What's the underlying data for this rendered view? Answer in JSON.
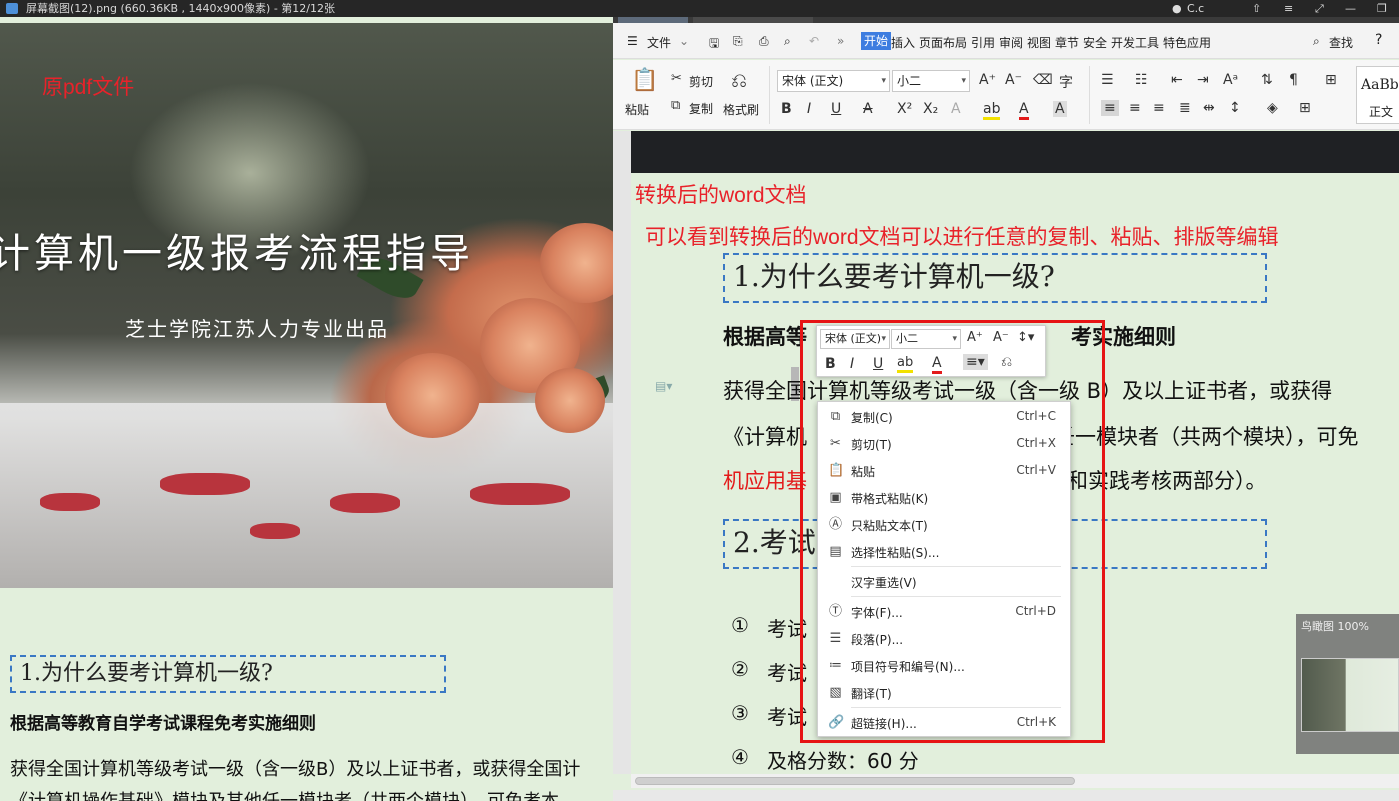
{
  "titlebar": {
    "title": "屏幕截图(12).png (660.36KB , 1440x900像素) - 第12/12张",
    "user": "C.c"
  },
  "left": {
    "label": "原pdf文件",
    "photo_title": "计算机一级报考流程指导",
    "photo_subtitle": "芝士学院江苏人力专业出品",
    "heading1": "1.为什么要考计算机一级?",
    "bold_line": "根据高等教育自学考试课程免考实施细则",
    "para_line1": "获得全国计算机等级考试一级（含一级B）及以上证书者，或获得全国计",
    "para_line2": "《计算机操作基础》模块及其他任一模块者（共两个模块），可免考本"
  },
  "menu": {
    "file": "文件",
    "items": [
      "开始",
      "插入",
      "页面布局",
      "引用",
      "审阅",
      "视图",
      "章节",
      "安全",
      "开发工具",
      "特色应用"
    ],
    "search": "查找",
    "help": "?"
  },
  "ribbon": {
    "paste": "粘贴",
    "cut": "剪切",
    "copy": "复制",
    "format_painter": "格式刷",
    "font_name": "宋体 (正文)",
    "font_size": "小二",
    "style_preview": "AaBb",
    "style_name": "正文"
  },
  "doc": {
    "label_converted": "转换后的word文档",
    "label_note": "可以看到转换后的word文档可以进行任意的复制、粘贴、排版等编辑",
    "heading1": "1.为什么要考计算机一级?",
    "bold_left": "根据高等",
    "bold_right": "考实施细则",
    "para1": "获得全国计算机等级考试一级（含一级 B）及以上证书者，或获得",
    "para2_left": "《计算机",
    "para2_right": "壬一模块者（共两个模块），可免",
    "para3_red": "机应用基",
    "para3_right": "和实践考核两部分）。",
    "heading2": "2.考试",
    "list": [
      {
        "num": "①",
        "text": "考试"
      },
      {
        "num": "②",
        "text": "考试"
      },
      {
        "num": "③",
        "text": "考试"
      },
      {
        "num": "④",
        "text": "及格分数：60 分"
      }
    ]
  },
  "minimap": {
    "title": "鸟瞰图 100%"
  },
  "minitoolbar": {
    "font_name": "宋体 (正文)",
    "font_size": "小二"
  },
  "context_menu": [
    {
      "label": "复制(C)",
      "key": "Ctrl+C",
      "icon": "copy-icon",
      "glyph": "⧉"
    },
    {
      "label": "剪切(T)",
      "key": "Ctrl+X",
      "icon": "scissors-icon",
      "glyph": "✂"
    },
    {
      "label": "粘贴",
      "key": "Ctrl+V",
      "icon": "paste-icon",
      "glyph": "📋"
    },
    {
      "label": "带格式粘贴(K)",
      "key": "",
      "icon": "paste-format-icon",
      "glyph": "▣"
    },
    {
      "label": "只粘贴文本(T)",
      "key": "",
      "icon": "paste-text-icon",
      "glyph": "Ⓐ"
    },
    {
      "label": "选择性粘贴(S)...",
      "key": "",
      "icon": "paste-special-icon",
      "glyph": "▤"
    },
    {
      "label": "汉字重选(V)",
      "key": "",
      "icon": "",
      "glyph": ""
    },
    {
      "label": "字体(F)...",
      "key": "Ctrl+D",
      "icon": "font-icon",
      "glyph": "Ⓣ"
    },
    {
      "label": "段落(P)...",
      "key": "",
      "icon": "paragraph-icon",
      "glyph": "☰"
    },
    {
      "label": "项目符号和编号(N)...",
      "key": "",
      "icon": "bullets-icon",
      "glyph": "≔"
    },
    {
      "label": "翻译(T)",
      "key": "",
      "icon": "translate-icon",
      "glyph": "▧"
    },
    {
      "label": "超链接(H)...",
      "key": "Ctrl+K",
      "icon": "link-icon",
      "glyph": "🔗"
    }
  ]
}
